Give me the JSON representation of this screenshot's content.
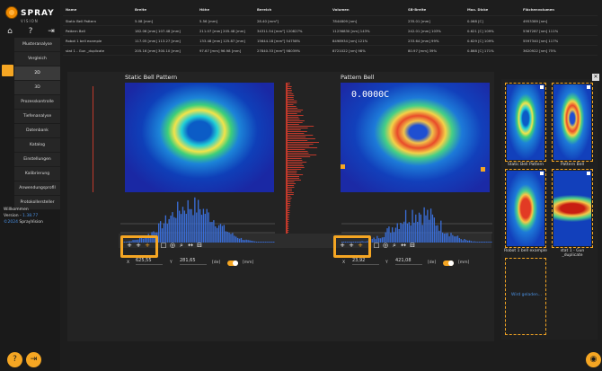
{
  "app": {
    "logo_text": "SPRAY",
    "logo_sub": "VISION"
  },
  "sidebar": {
    "items": [
      {
        "label": "Musteranalyse"
      },
      {
        "label": "Vergleich"
      },
      {
        "label": "2D"
      },
      {
        "label": "3D"
      },
      {
        "label": "Prozesskontrolle"
      },
      {
        "label": "Tiefenanalyse"
      },
      {
        "label": "Datenbank"
      },
      {
        "label": "Katalog"
      },
      {
        "label": "Einstellungen"
      },
      {
        "label": "Kalibrierung"
      },
      {
        "label": "Anwendungsprofil"
      },
      {
        "label": "Protokollersteller"
      }
    ],
    "welcome_title": "Willkommen",
    "version_label": "Version - ",
    "version_value": "1.38.77",
    "copyright_label": "©2024 ",
    "copyright_name": "SprayVision"
  },
  "table": {
    "headers": [
      "Name",
      "Breite",
      "Höhe",
      "Bereich",
      "Volumen",
      "SB-Breite",
      "Max. Dicke",
      "Flächenvolumen"
    ],
    "rows": [
      [
        "Static Bell Pattern",
        "5.08 [mm]",
        "5.56 [mm]",
        "28.40 [mm²]",
        "7844809 [nm]",
        "235.01 [mm]",
        "0.068 [C]",
        "4953389 [nm]"
      ],
      [
        "Pattern Bell",
        "182.06 [mm] 107.48 [mm]",
        "211.07 [mm] 205.48 [mm]",
        "34311.54 [mm²] 120827%",
        "11236830 [nm] 143%",
        "242.01 [mm] 103%",
        "0.621 [C] 109%",
        "5367287 [nm] 111%"
      ],
      [
        "Robot 1 bell example",
        "117.05 [mm] 113.27 [mm]",
        "133.48 [mm] 125.87 [mm]",
        "15644.18 [mm²] 54758%",
        "8498934 [nm] 121%",
        "233.64 [mm] 99%",
        "0.629 [C] 109%",
        "5597340 [nm] 117%"
      ],
      [
        "stat 1 - Gun _duplicate",
        "205.16 [mm] 300.10 [mm]",
        "97.67 [mm] 96.98 [mm]",
        "27840.33 [mm²] 98039%",
        "8721022 [nm] 98%",
        "80.97 [mm] 39%",
        "0.868 [C] 171%",
        "3620922 [nm] 75%"
      ]
    ]
  },
  "panels": {
    "left_title": "Static Bell Pattern",
    "right_title": "Pattern Bell",
    "right_value": "0.0000C"
  },
  "coords": {
    "left_x_label": "X",
    "left_x": "625,55",
    "left_y_label": "Y",
    "left_y": "281,65",
    "right_x_label": "X",
    "right_x": "23,92",
    "right_y_label": "Y",
    "right_y": "421,08",
    "unit_deg": "[de]",
    "unit_mm": "[mm]"
  },
  "thumbs": [
    {
      "label": "Static Bell Pattern"
    },
    {
      "label": "Pattern Bell"
    },
    {
      "label": "Robot 1 bell example"
    },
    {
      "label": "stat 1 - Gun _duplicate"
    },
    {
      "label": "Wird geladen..."
    }
  ],
  "colors": {
    "accent": "#f5a623",
    "link": "#4a90e2"
  }
}
